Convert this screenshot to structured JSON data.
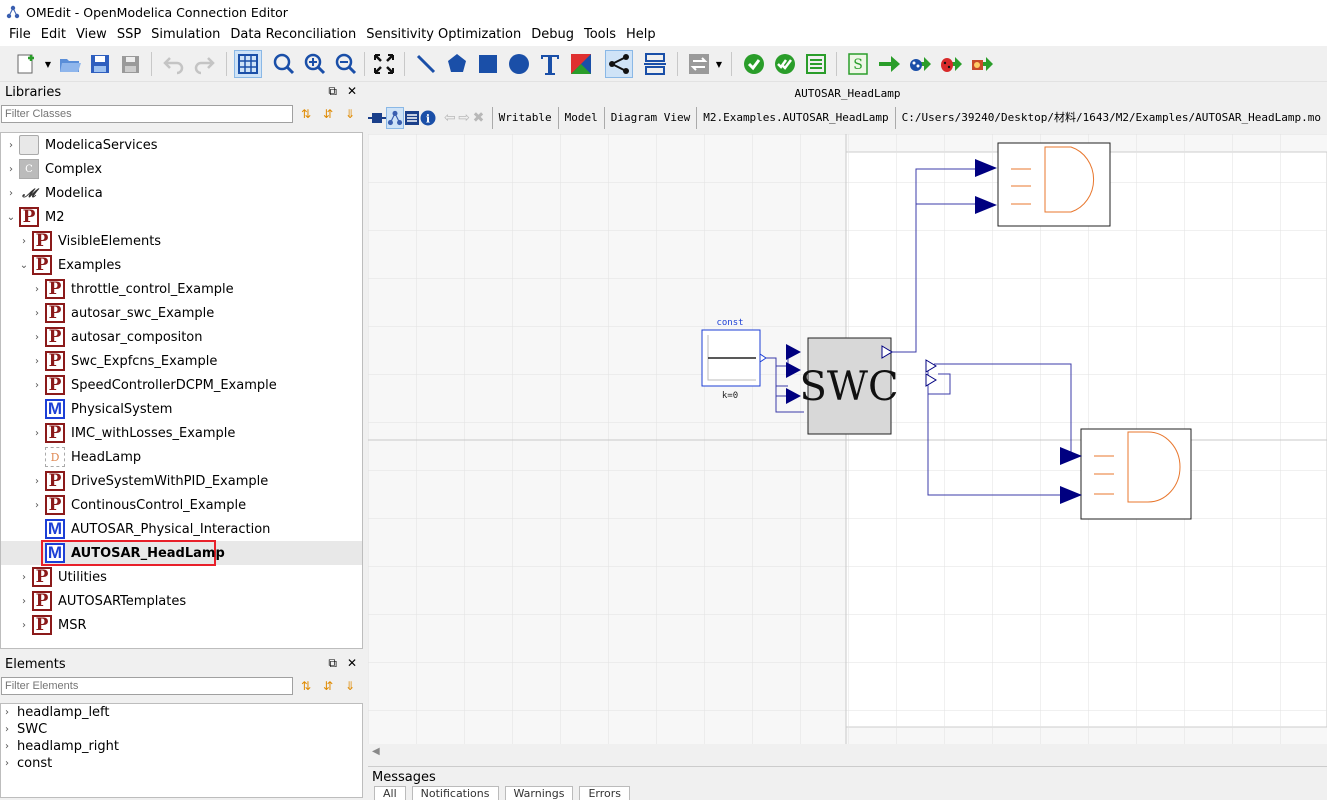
{
  "window": {
    "title": "OMEdit - OpenModelica Connection Editor"
  },
  "menu": [
    "File",
    "Edit",
    "View",
    "SSP",
    "Simulation",
    "Data Reconciliation",
    "Sensitivity Optimization",
    "Debug",
    "Tools",
    "Help"
  ],
  "libraries": {
    "title": "Libraries",
    "filter_placeholder": "Filter Classes",
    "items": [
      {
        "label": "ModelicaServices",
        "icon": "package-icon",
        "level": 0,
        "expand": "closed"
      },
      {
        "label": "Complex",
        "icon": "complex-icon",
        "level": 0,
        "expand": "closed"
      },
      {
        "label": "Modelica",
        "icon": "modelica-icon",
        "level": 0,
        "expand": "closed"
      },
      {
        "label": "M2",
        "icon": "package-p-icon",
        "level": 0,
        "expand": "open"
      },
      {
        "label": "VisibleElements",
        "icon": "package-p-icon",
        "level": 1,
        "expand": "closed"
      },
      {
        "label": "Examples",
        "icon": "package-p-icon",
        "level": 1,
        "expand": "open"
      },
      {
        "label": "throttle_control_Example",
        "icon": "package-p-icon",
        "level": 2,
        "expand": "closed"
      },
      {
        "label": "autosar_swc_Example",
        "icon": "package-p-icon",
        "level": 2,
        "expand": "closed"
      },
      {
        "label": "autosar_compositon",
        "icon": "package-p-icon",
        "level": 2,
        "expand": "closed"
      },
      {
        "label": "Swc_Expfcns_Example",
        "icon": "package-p-icon",
        "level": 2,
        "expand": "closed"
      },
      {
        "label": "SpeedControllerDCPM_Example",
        "icon": "package-p-icon",
        "level": 2,
        "expand": "closed"
      },
      {
        "label": "PhysicalSystem",
        "icon": "model-m-icon",
        "level": 2,
        "expand": "none"
      },
      {
        "label": "IMC_withLosses_Example",
        "icon": "package-p-icon",
        "level": 2,
        "expand": "closed"
      },
      {
        "label": "HeadLamp",
        "icon": "headlamp-icon",
        "level": 2,
        "expand": "none"
      },
      {
        "label": "DriveSystemWithPID_Example",
        "icon": "package-p-icon",
        "level": 2,
        "expand": "closed"
      },
      {
        "label": "ContinousControl_Example",
        "icon": "package-p-icon",
        "level": 2,
        "expand": "closed"
      },
      {
        "label": "AUTOSAR_Physical_Interaction",
        "icon": "model-m-icon",
        "level": 2,
        "expand": "none"
      },
      {
        "label": "AUTOSAR_HeadLamp",
        "icon": "model-m-icon",
        "level": 2,
        "expand": "none",
        "selected": true
      },
      {
        "label": "Utilities",
        "icon": "package-p-icon",
        "level": 1,
        "expand": "closed"
      },
      {
        "label": "AUTOSARTemplates",
        "icon": "package-p-icon",
        "level": 1,
        "expand": "closed"
      },
      {
        "label": "MSR",
        "icon": "package-p-icon",
        "level": 1,
        "expand": "closed"
      }
    ]
  },
  "elements": {
    "title": "Elements",
    "filter_placeholder": "Filter Elements",
    "items": [
      "headlamp_left",
      "SWC",
      "headlamp_right",
      "const"
    ]
  },
  "document": {
    "title": "AUTOSAR_HeadLamp",
    "status": [
      "Writable",
      "Model",
      "Diagram View",
      "M2.Examples.AUTOSAR_HeadLamp",
      "C:/Users/39240/Desktop/材料/1643/M2/Examples/AUTOSAR_HeadLamp.mo"
    ]
  },
  "diagram": {
    "const_label": "const",
    "const_param": "k=0",
    "swc_label": "SWC"
  },
  "messages": {
    "title": "Messages",
    "tabs": [
      "All",
      "Notifications",
      "Warnings",
      "Errors"
    ]
  },
  "colors": {
    "connector": "#000080",
    "lamp": "#e8772e",
    "highlight": "#e8202a"
  }
}
